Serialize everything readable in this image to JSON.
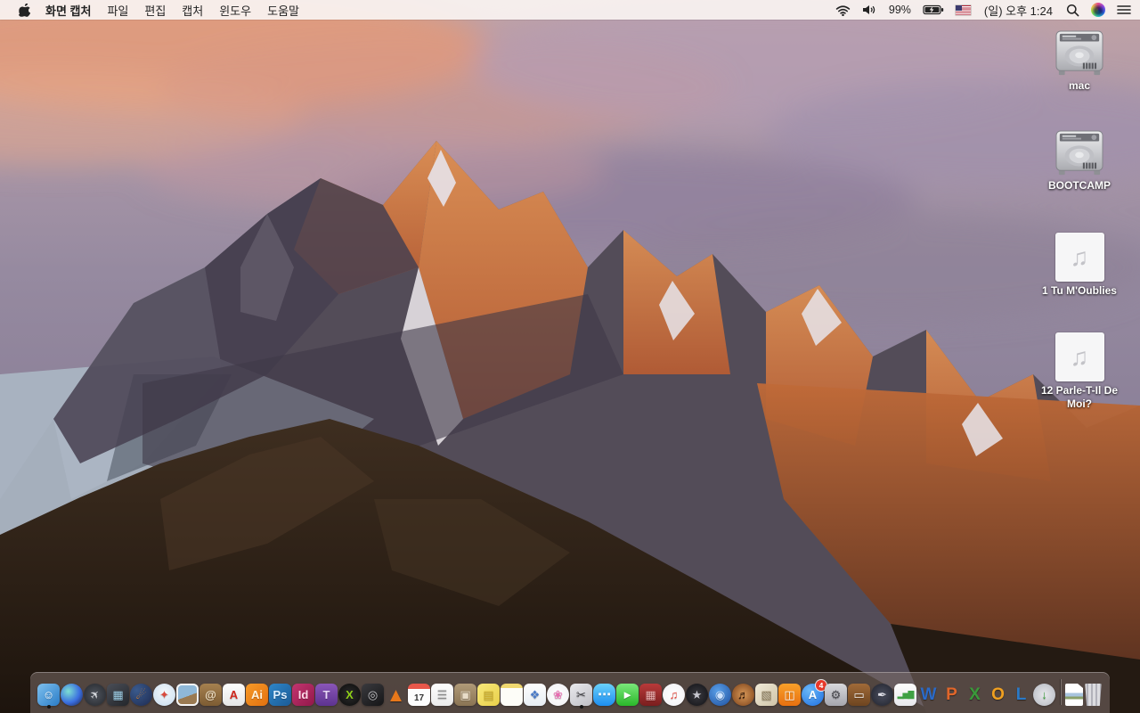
{
  "menu_bar": {
    "app_name": "화면 캡처",
    "menus": [
      "파일",
      "편집",
      "캡처",
      "윈도우",
      "도움말"
    ],
    "status": {
      "battery_percent": "99%",
      "clock": "(일) 오후 1:24",
      "icons_right_to_left": [
        "notification-center",
        "siri",
        "spotlight-search",
        "clock",
        "us-flag",
        "battery-charging",
        "battery-percent",
        "volume",
        "wifi"
      ]
    }
  },
  "desktop": {
    "audio_glyph": "♫",
    "icons": [
      {
        "name": "mac",
        "type": "drive",
        "label": "mac"
      },
      {
        "name": "bootcamp",
        "type": "drive",
        "label": "BOOTCAMP"
      },
      {
        "name": "song-1",
        "type": "audio",
        "label": "1 Tu M'Oublies"
      },
      {
        "name": "song-12",
        "type": "audio",
        "label": "12 Parle-T-Il De Moi?"
      }
    ]
  },
  "dock": {
    "items": [
      {
        "name": "finder",
        "shape": "tile",
        "glyph": "☺",
        "bg": "linear-gradient(135deg,#7ec0ee,#2a7cc7)",
        "fg": "#ffffff",
        "running": true
      },
      {
        "name": "siri",
        "shape": "circle",
        "glyph": "",
        "bg": "radial-gradient(circle at 35% 35%,#7de0d2,#3a6ee0 55%,#1b1f3a)"
      },
      {
        "name": "launchpad",
        "shape": "circle",
        "kind": "rocket",
        "glyph": "✈",
        "bg": "radial-gradient(circle,#50555e,#23262b)",
        "fg": "#d8dbe0"
      },
      {
        "name": "mission-control",
        "shape": "tile",
        "glyph": "▦",
        "bg": "linear-gradient(145deg,#4a4e57,#23262b)",
        "fg": "#9fd0e8"
      },
      {
        "name": "firefox",
        "shape": "circle",
        "glyph": "☄",
        "bg": "radial-gradient(circle at 30% 30%,#3a5a8c,#1e2a50)",
        "fg": "#f08a24"
      },
      {
        "name": "safari",
        "shape": "circle",
        "glyph": "✦",
        "bg": "radial-gradient(circle at 50% 40%,#f4f8fb,#c6dcef)",
        "fg": "#d84a3e"
      },
      {
        "name": "preview",
        "shape": "tile",
        "kind": "photo",
        "glyph": "",
        "bg": "linear-gradient(160deg,#8fb8d8 0 55%,#9a7a52 55% 100%)"
      },
      {
        "name": "contacts",
        "shape": "tile",
        "glyph": "@",
        "bg": "linear-gradient(180deg,#a5804f,#7d5c33)",
        "fg": "#f0e2c8"
      },
      {
        "name": "acrobat",
        "shape": "tile",
        "glyph": "A",
        "bg": "linear-gradient(180deg,#fdfdfd,#e6e6e6)",
        "fg": "#d0281e"
      },
      {
        "name": "illustrator",
        "shape": "tile",
        "glyph": "Ai",
        "bg": "linear-gradient(135deg,#f79a28,#e2700f)",
        "fg": "#fff3dc"
      },
      {
        "name": "photoshop",
        "shape": "tile",
        "glyph": "Ps",
        "bg": "linear-gradient(135deg,#2e86c8,#1b5a96)",
        "fg": "#dff0ff"
      },
      {
        "name": "indesign",
        "shape": "tile",
        "glyph": "Id",
        "bg": "linear-gradient(135deg,#c2356f,#92184a)",
        "fg": "#ffd9e8"
      },
      {
        "name": "toast-titanium",
        "shape": "tile",
        "glyph": "T",
        "bg": "linear-gradient(180deg,#8a56b8,#5d3390)",
        "fg": "#e8d8f8"
      },
      {
        "name": "video-converter-x",
        "shape": "circle",
        "glyph": "X",
        "bg": "radial-gradient(circle,#2c2c2c,#0b0b0b)",
        "fg": "#8fd018"
      },
      {
        "name": "disk-tool",
        "shape": "tile",
        "glyph": "◎",
        "bg": "linear-gradient(145deg,#3a3a3e,#151517)",
        "fg": "#c8c8cc"
      },
      {
        "name": "vlc",
        "shape": "none",
        "kind": "cone",
        "glyph": "▲",
        "fg": "#e8781a"
      },
      {
        "name": "calendar",
        "shape": "tile",
        "kind": "calendar",
        "glyph": "17",
        "bg": "linear-gradient(180deg,#e8574a 0 24%,#fdfdfd 24%)",
        "fg": "#333333"
      },
      {
        "name": "reminders",
        "shape": "tile",
        "glyph": "☰",
        "bg": "linear-gradient(180deg,#fdfdfd,#ebebeb)",
        "fg": "#8a8a8a"
      },
      {
        "name": "stuffit-expander",
        "shape": "tile",
        "glyph": "▣",
        "bg": "linear-gradient(180deg,#b09a78,#8a7454)",
        "fg": "#e8dcc8"
      },
      {
        "name": "stickies",
        "shape": "tile",
        "glyph": "▤",
        "bg": "linear-gradient(135deg,#f8e87a,#e8d04a)",
        "fg": "#c8a828"
      },
      {
        "name": "notes",
        "shape": "tile",
        "glyph": "",
        "bg": "linear-gradient(180deg,#f0d870 0 20%,#fdfdf8 20%)"
      },
      {
        "name": "document-templates",
        "shape": "tile",
        "glyph": "❖",
        "bg": "linear-gradient(180deg,#fdfdfd,#e8eef4)",
        "fg": "#4a7ac8"
      },
      {
        "name": "photos",
        "shape": "circle",
        "glyph": "❀",
        "bg": "radial-gradient(circle,#ffffff,#efeff2)",
        "fg": "#e86ab0"
      },
      {
        "name": "grab",
        "shape": "tile",
        "glyph": "✂",
        "bg": "linear-gradient(145deg,#e9e9ed,#bfbfc5)",
        "fg": "#3a3a3e",
        "running": true
      },
      {
        "name": "messages",
        "shape": "tile",
        "kind": "bubble",
        "glyph": "⋯",
        "bg": "linear-gradient(180deg,#6ad0fa,#1d8ef0)",
        "fg": "#ffffff"
      },
      {
        "name": "facetime",
        "shape": "tile",
        "glyph": "►",
        "bg": "linear-gradient(180deg,#7ae87a,#2ab82a)",
        "fg": "#ffffff"
      },
      {
        "name": "photo-booth",
        "shape": "tile",
        "glyph": "▦",
        "bg": "linear-gradient(180deg,#b83a3a,#7a1e1e)",
        "fg": "#e8b0b0"
      },
      {
        "name": "itunes",
        "shape": "circle",
        "glyph": "♫",
        "bg": "radial-gradient(circle,#ffffff,#f0f0f4)",
        "fg": "#e8463c"
      },
      {
        "name": "imovie",
        "shape": "circle",
        "glyph": "★",
        "bg": "radial-gradient(circle,#3a3a40,#111115)",
        "fg": "#c8c8d0"
      },
      {
        "name": "idvd",
        "shape": "circle",
        "glyph": "◉",
        "bg": "radial-gradient(circle at 40% 35%,#5aa0e8,#1d4e9e)",
        "fg": "#cfe4ff"
      },
      {
        "name": "garageband",
        "shape": "circle",
        "glyph": "♬",
        "bg": "radial-gradient(circle,#d89858,#7a4018)",
        "fg": "#2e1608"
      },
      {
        "name": "iweb",
        "shape": "tile",
        "glyph": "▧",
        "bg": "linear-gradient(135deg,#f0ead8,#cfc4a8)",
        "fg": "#8a7a5a"
      },
      {
        "name": "ibooks",
        "shape": "tile",
        "glyph": "◫",
        "bg": "linear-gradient(180deg,#f8a02a,#e87010)",
        "fg": "#ffffff"
      },
      {
        "name": "app-store",
        "shape": "circle",
        "glyph": "A",
        "bg": "radial-gradient(circle at 35% 30%,#6ab8f8,#1e6ee0)",
        "fg": "#ffffff",
        "badge": "4"
      },
      {
        "name": "system-preferences",
        "shape": "tile",
        "glyph": "⚙",
        "bg": "linear-gradient(180deg,#d8d8dc,#a6a6ae)",
        "fg": "#4a4a50"
      },
      {
        "name": "keynote",
        "shape": "tile",
        "glyph": "▭",
        "bg": "linear-gradient(180deg,#a06a38,#6e4520)",
        "fg": "#f4f4f4"
      },
      {
        "name": "pages",
        "shape": "circle",
        "glyph": "✒",
        "bg": "radial-gradient(circle,#4a4e5e,#20222c)",
        "fg": "#e0e0e8"
      },
      {
        "name": "numbers",
        "shape": "tile",
        "kind": "bars",
        "glyph": "▂▅▇",
        "bg": "linear-gradient(180deg,#fdfdfd,#e8e8ec)",
        "fg": "#3fa144"
      },
      {
        "name": "word",
        "shape": "none",
        "glyph": "W",
        "fg": "#2a6ac8"
      },
      {
        "name": "powerpoint",
        "shape": "none",
        "glyph": "P",
        "fg": "#e0662a"
      },
      {
        "name": "excel",
        "shape": "none",
        "glyph": "X",
        "fg": "#3a9a3a"
      },
      {
        "name": "outlook",
        "shape": "none",
        "glyph": "O",
        "fg": "#f0a020"
      },
      {
        "name": "lync",
        "shape": "none",
        "glyph": "L",
        "fg": "#2a7ac8"
      },
      {
        "name": "document-connection",
        "shape": "circle",
        "glyph": "↓",
        "bg": "radial-gradient(circle,#e8e8ec,#b4b8c0)",
        "fg": "#3aa03a"
      },
      {
        "separator": true
      },
      {
        "name": "image-file",
        "shape": "tile",
        "kind": "file",
        "glyph": "",
        "bg": "linear-gradient(180deg,#ffffff 0 42%,#a8c4de 42% 58%,#8aa06a 58% 70%,#ffffff 70%)"
      },
      {
        "name": "trash",
        "shape": "tile",
        "kind": "trash",
        "glyph": "",
        "bg": "repeating-linear-gradient(90deg,#dcdce0 0 3px,#b2b2ba 3px 5px)"
      }
    ]
  },
  "theme": {
    "menubar_bg": "#f9f3f1",
    "dock_bg": "rgba(124,110,106,0.55)",
    "sky_top": "#c2a3a6",
    "sky_mid": "#968aa0",
    "cloud_orange": "#e89a72",
    "sunlit_rock": "#e09154",
    "shadow_rock": "#474050",
    "snow": "#e6e1e6",
    "foreground_rock": "#2c2118",
    "badge_red": "#e8382a"
  }
}
